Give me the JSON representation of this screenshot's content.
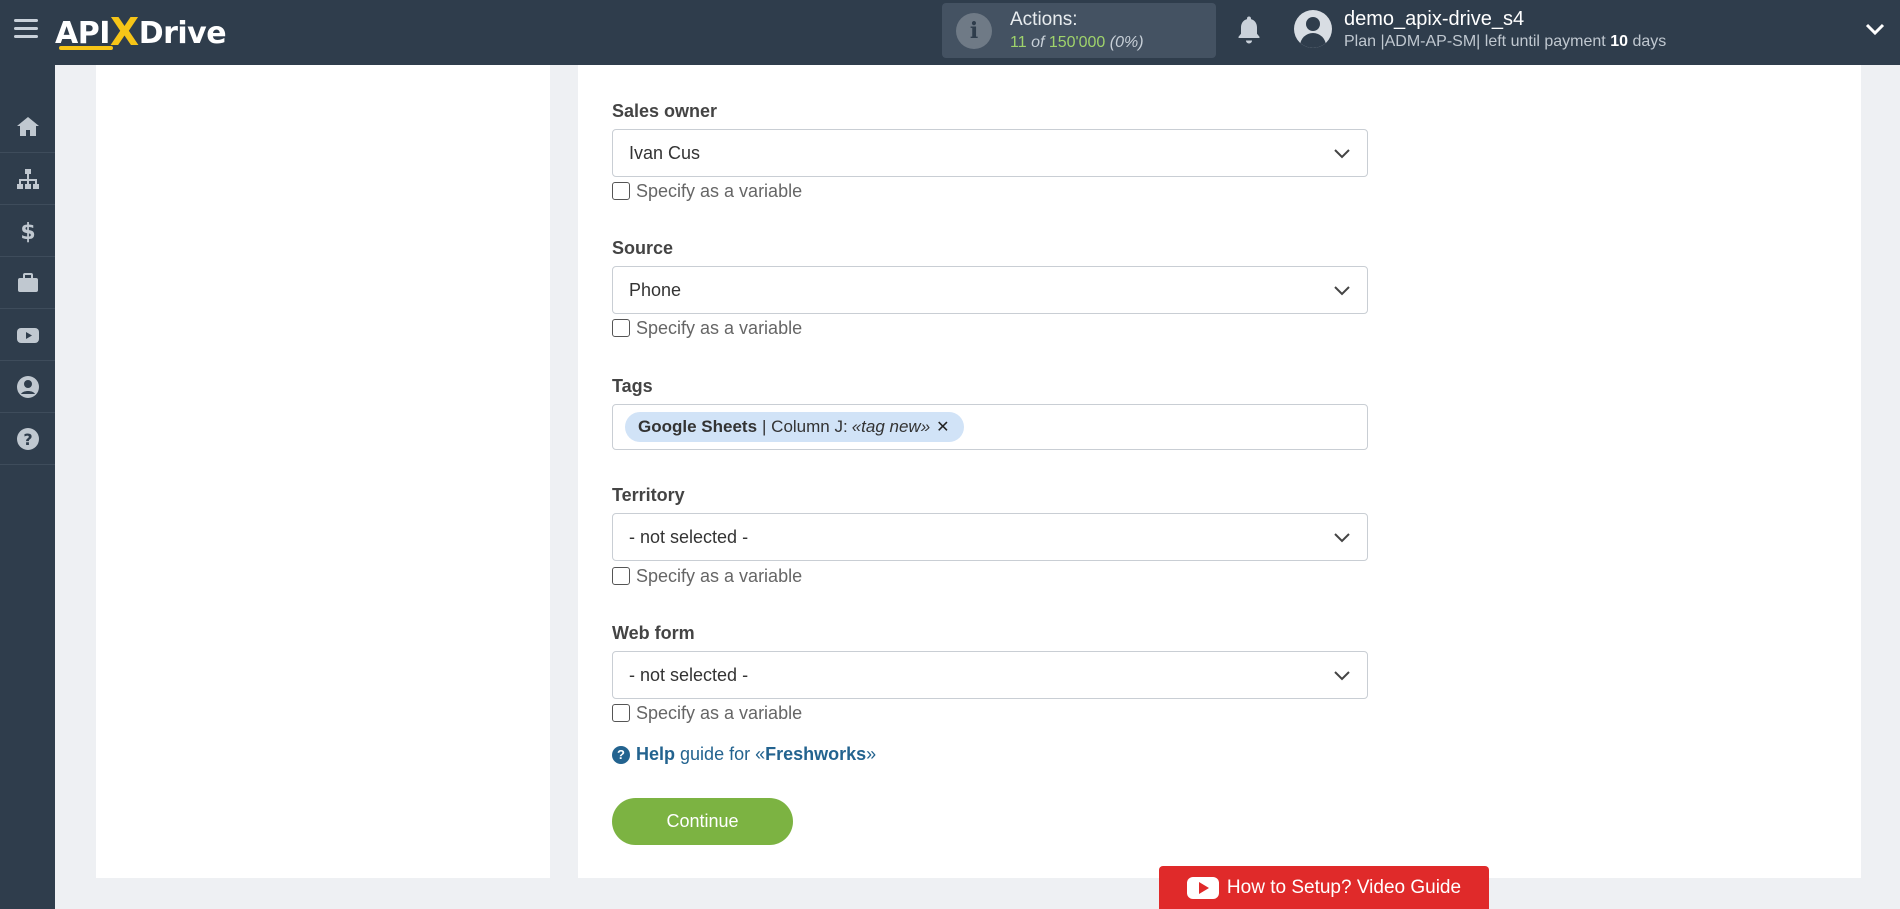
{
  "header": {
    "logo_text_left": "API",
    "logo_text_x": "X",
    "logo_text_right": "Drive",
    "actions_label": "Actions:",
    "actions_used": "11",
    "actions_of": "of",
    "actions_total": "150'000",
    "actions_percent": "(0%)",
    "username": "demo_apix-drive_s4",
    "plan_prefix": "Plan |ADM-AP-SM| left until payment",
    "plan_days": "10",
    "plan_suffix": "days"
  },
  "sidebar": {
    "items": [
      {
        "icon": "home-icon"
      },
      {
        "icon": "sitemap-icon"
      },
      {
        "icon": "dollar-icon"
      },
      {
        "icon": "briefcase-icon"
      },
      {
        "icon": "youtube-icon"
      },
      {
        "icon": "user-circle-icon"
      },
      {
        "icon": "question-circle-icon"
      }
    ]
  },
  "form": {
    "sales_owner": {
      "label": "Sales owner",
      "value": "Ivan Cus",
      "variable_label": "Specify as a variable"
    },
    "source": {
      "label": "Source",
      "value": "Phone",
      "variable_label": "Specify as a variable"
    },
    "tags": {
      "label": "Tags",
      "tag_source": "Google Sheets",
      "tag_separator": "| Column J:",
      "tag_value": "«tag new»"
    },
    "territory": {
      "label": "Territory",
      "value": "- not selected -",
      "variable_label": "Specify as a variable"
    },
    "web_form": {
      "label": "Web form",
      "value": "- not selected -",
      "variable_label": "Specify as a variable"
    },
    "help_bold": "Help",
    "help_mid": "guide for «",
    "help_service": "Freshworks",
    "help_end": "»",
    "continue_label": "Continue"
  },
  "video_guide_label": "How to Setup? Video Guide"
}
